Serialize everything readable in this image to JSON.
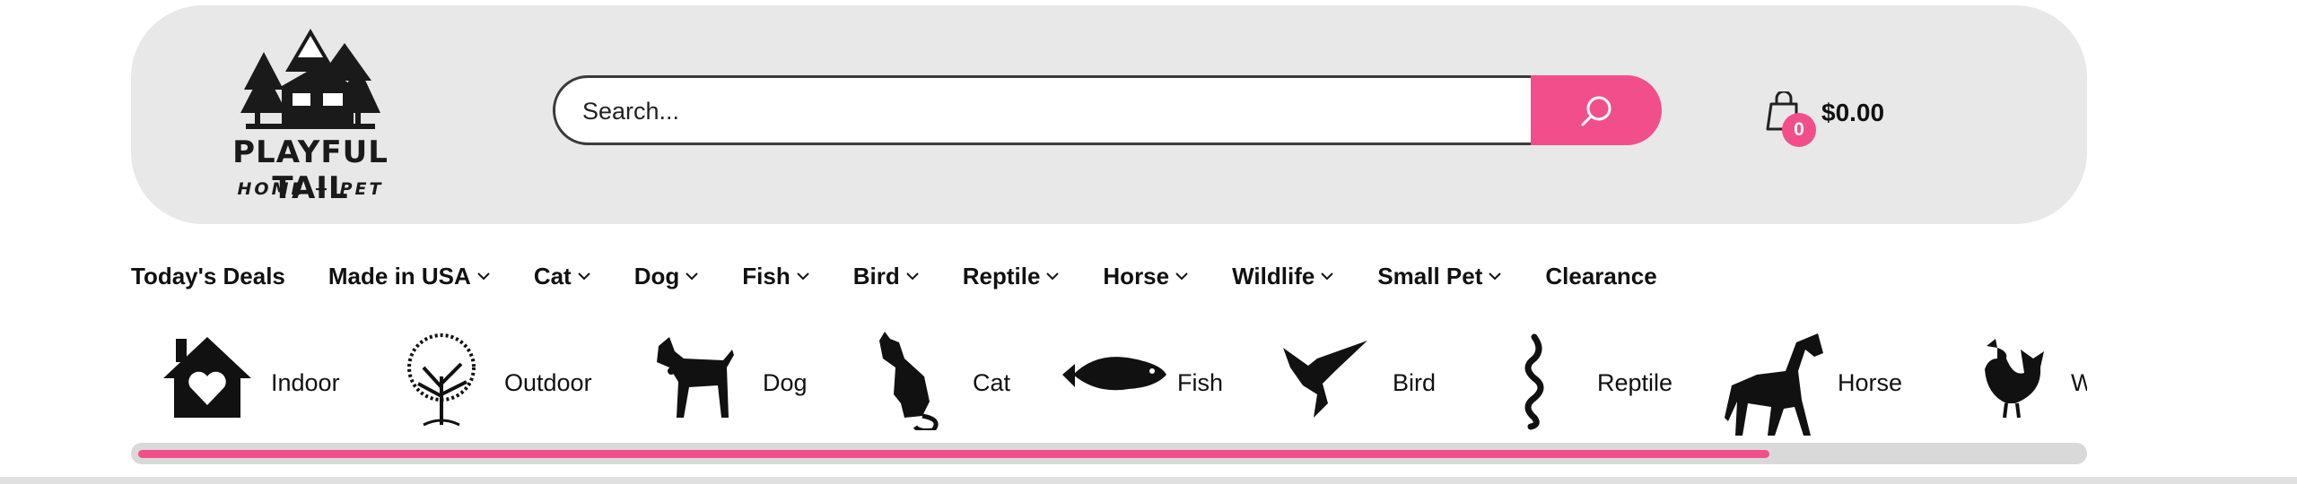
{
  "brand": {
    "name": "PLAYFUL TAIL",
    "tagline": "HOME + PET"
  },
  "search": {
    "placeholder": "Search...",
    "value": ""
  },
  "cart": {
    "count": "0",
    "total": "$0.00"
  },
  "nav": [
    {
      "label": "Today's Deals",
      "dropdown": false
    },
    {
      "label": "Made in USA",
      "dropdown": true
    },
    {
      "label": "Cat",
      "dropdown": true
    },
    {
      "label": "Dog",
      "dropdown": true
    },
    {
      "label": "Fish",
      "dropdown": true
    },
    {
      "label": "Bird",
      "dropdown": true
    },
    {
      "label": "Reptile",
      "dropdown": true
    },
    {
      "label": "Horse",
      "dropdown": true
    },
    {
      "label": "Wildlife",
      "dropdown": true
    },
    {
      "label": "Small Pet",
      "dropdown": true
    },
    {
      "label": "Clearance",
      "dropdown": false
    }
  ],
  "categories": [
    {
      "label": "Indoor",
      "icon": "house-heart-icon"
    },
    {
      "label": "Outdoor",
      "icon": "tree-icon"
    },
    {
      "label": "Dog",
      "icon": "dog-icon"
    },
    {
      "label": "Cat",
      "icon": "cat-icon"
    },
    {
      "label": "Fish",
      "icon": "fish-icon"
    },
    {
      "label": "Bird",
      "icon": "bird-icon"
    },
    {
      "label": "Reptile",
      "icon": "snake-icon"
    },
    {
      "label": "Horse",
      "icon": "horse-icon"
    },
    {
      "label": "W",
      "icon": "chicken-icon"
    }
  ],
  "scroll_progress": 0.84,
  "colors": {
    "accent": "#f14f8c",
    "header_bg": "#e8e8e8"
  }
}
